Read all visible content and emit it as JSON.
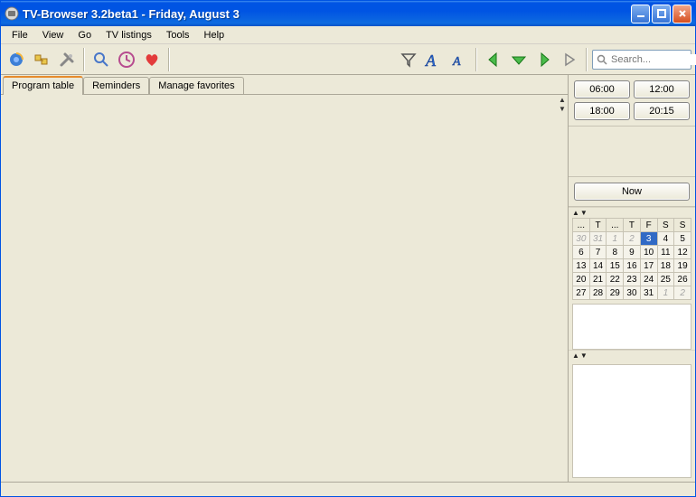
{
  "window": {
    "title": "TV-Browser 3.2beta1 - Friday, August 3"
  },
  "menu": {
    "file": "File",
    "view": "View",
    "go": "Go",
    "tvlistings": "TV listings",
    "tools": "Tools",
    "help": "Help"
  },
  "search": {
    "placeholder": "Search..."
  },
  "tabs": {
    "program_table": "Program table",
    "reminders": "Reminders",
    "manage_favorites": "Manage favorites"
  },
  "time_buttons": {
    "t1": "06:00",
    "t2": "12:00",
    "t3": "18:00",
    "t4": "20:15",
    "now": "Now"
  },
  "calendar": {
    "headers": [
      "...",
      "T",
      "...",
      "T",
      "F",
      "S",
      "S"
    ],
    "rows": [
      [
        {
          "v": "30",
          "o": true
        },
        {
          "v": "31",
          "o": true
        },
        {
          "v": "1",
          "o": true
        },
        {
          "v": "2",
          "o": true
        },
        {
          "v": "3",
          "sel": true
        },
        {
          "v": "4"
        },
        {
          "v": "5"
        }
      ],
      [
        {
          "v": "6"
        },
        {
          "v": "7"
        },
        {
          "v": "8"
        },
        {
          "v": "9"
        },
        {
          "v": "10"
        },
        {
          "v": "11"
        },
        {
          "v": "12"
        }
      ],
      [
        {
          "v": "13"
        },
        {
          "v": "14"
        },
        {
          "v": "15"
        },
        {
          "v": "16"
        },
        {
          "v": "17"
        },
        {
          "v": "18"
        },
        {
          "v": "19"
        }
      ],
      [
        {
          "v": "20"
        },
        {
          "v": "21"
        },
        {
          "v": "22"
        },
        {
          "v": "23"
        },
        {
          "v": "24"
        },
        {
          "v": "25"
        },
        {
          "v": "26"
        }
      ],
      [
        {
          "v": "27"
        },
        {
          "v": "28"
        },
        {
          "v": "29"
        },
        {
          "v": "30"
        },
        {
          "v": "31"
        },
        {
          "v": "1",
          "o": true
        },
        {
          "v": "2",
          "o": true
        }
      ]
    ]
  }
}
